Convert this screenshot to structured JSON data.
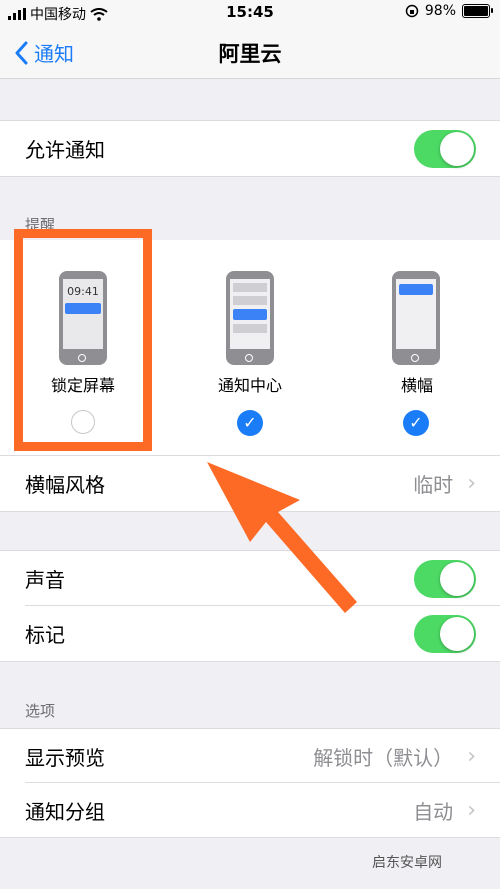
{
  "status": {
    "carrier": "中国移动",
    "time": "15:45",
    "battery": "98%"
  },
  "nav": {
    "back_label": "通知",
    "title": "阿里云"
  },
  "allow_notifications": {
    "label": "允许通知",
    "enabled": true
  },
  "alerts": {
    "header": "提醒",
    "lock_screen": {
      "label": "锁定屏幕",
      "time_text": "09:41",
      "checked": false
    },
    "notification_center": {
      "label": "通知中心",
      "checked": true
    },
    "banners": {
      "label": "横幅",
      "checked": true
    }
  },
  "banner_style": {
    "label": "横幅风格",
    "value": "临时"
  },
  "sounds": {
    "label": "声音",
    "enabled": true
  },
  "badges": {
    "label": "标记",
    "enabled": true
  },
  "options": {
    "header": "选项",
    "show_previews": {
      "label": "显示预览",
      "value": "解锁时（默认）"
    },
    "notification_grouping": {
      "label": "通知分组",
      "value": "自动"
    }
  },
  "watermark": "启东安卓网",
  "colors": {
    "accent": "#1a7cf7",
    "toggle_on": "#4cd964",
    "highlight": "#fd6a26"
  }
}
